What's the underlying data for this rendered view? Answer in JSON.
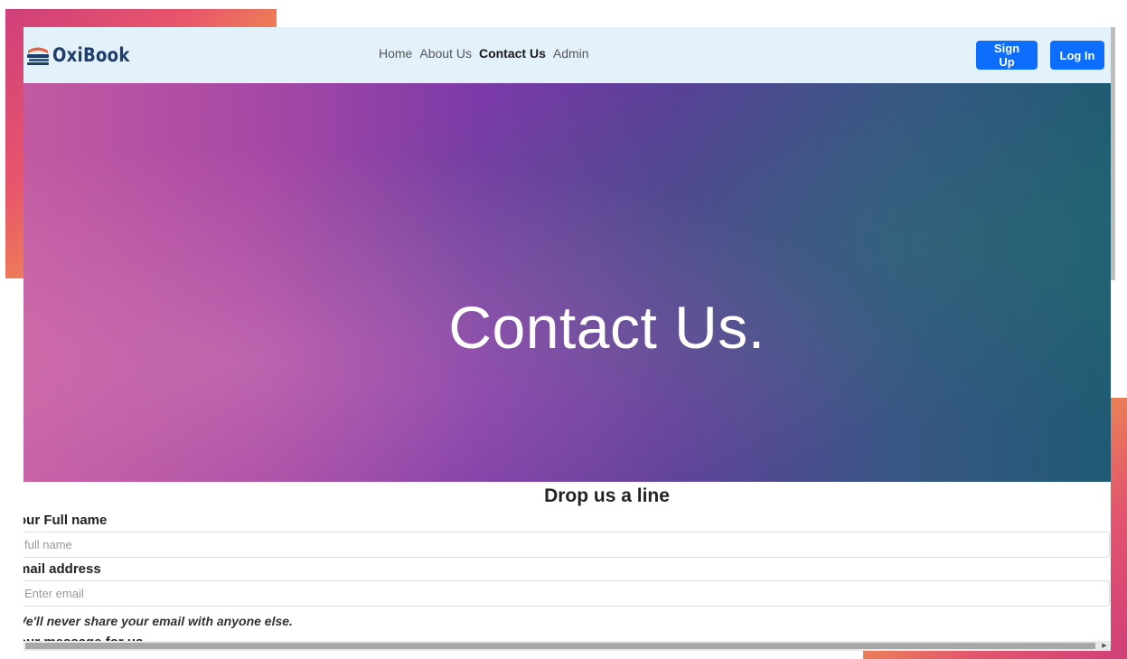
{
  "brand": {
    "name": "OxiBook",
    "logo_icon": "book-stack-icon"
  },
  "nav": {
    "links": [
      {
        "label": "Home",
        "active": false
      },
      {
        "label": "About Us",
        "active": false
      },
      {
        "label": "Contact Us",
        "active": true
      },
      {
        "label": "Admin",
        "active": false
      }
    ],
    "signup_label": "Sign Up",
    "login_label": "Log In"
  },
  "hero": {
    "title": "Contact Us."
  },
  "form": {
    "heading": "Drop us a line",
    "name_label": "our Full name",
    "name_placeholder": "full name",
    "email_label": "mail address",
    "email_placeholder": "Enter email",
    "email_hint": "Ve'll never share your email with anyone else.",
    "message_label": "our message for us"
  },
  "colors": {
    "navbar_bg": "#e3f1fb",
    "button_primary": "#0d6efd",
    "brand_text": "#1f3d6b"
  }
}
